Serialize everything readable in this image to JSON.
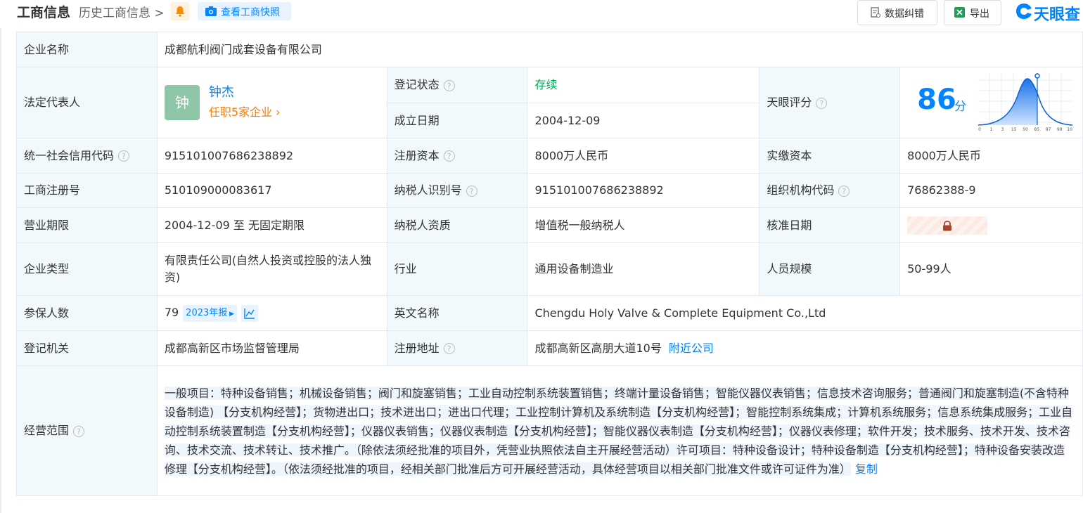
{
  "header": {
    "title": "工商信息",
    "history_link": "历史工商信息",
    "snapshot_label": "查看工商快照",
    "correct_label": "数据纠错",
    "export_label": "导出",
    "logo_text": "天眼查",
    "bell_icon": "bell-icon",
    "camera_icon": "camera-icon"
  },
  "company": {
    "name_label": "企业名称",
    "name": "成都航利阀门成套设备有限公司",
    "legal_rep_label": "法定代表人",
    "legal_rep": "钟杰",
    "avatar_char": "钟",
    "legal_rep_posts": "任职5家企业",
    "reg_status_label": "登记状态",
    "reg_status": "存续",
    "established_label": "成立日期",
    "established": "2004-12-09",
    "score_label": "天眼评分",
    "score": "86",
    "score_unit": "分",
    "score_ticks": [
      "0",
      "1",
      "3",
      "15",
      "50",
      "85",
      "97",
      "99",
      "100"
    ],
    "credit_code_label": "统一社会信用代码",
    "credit_code": "915101007686238892",
    "reg_capital_label": "注册资本",
    "reg_capital": "8000万人民币",
    "paid_capital_label": "实缴资本",
    "paid_capital": "8000万人民币",
    "reg_no_label": "工商注册号",
    "reg_no": "510109000083617",
    "taxpayer_id_label": "纳税人识别号",
    "taxpayer_id": "915101007686238892",
    "org_code_label": "组织机构代码",
    "org_code": "76862388-9",
    "term_label": "营业期限",
    "term": "2004-12-09 至 无固定期限",
    "tax_qual_label": "纳税人资质",
    "tax_qual": "增值税一般纳税人",
    "approval_label": "核准日期",
    "type_label": "企业类型",
    "type": "有限责任公司(自然人投资或控股的法人独资)",
    "industry_label": "行业",
    "industry": "通用设备制造业",
    "staff_label": "人员规模",
    "staff": "50-99人",
    "insured_label": "参保人数",
    "insured": "79",
    "report_chip": "2023年报",
    "en_name_label": "英文名称",
    "en_name": "Chengdu Holy Valve & Complete Equipment Co.,Ltd",
    "authority_label": "登记机关",
    "authority": "成都高新区市场监督管理局",
    "address_label": "注册地址",
    "address": "成都高新区高朋大道10号",
    "nearby": "附近公司",
    "scope_label": "经营范围",
    "scope": "一般项目：特种设备销售；机械设备销售；阀门和旋塞销售；工业自动控制系统装置销售；终端计量设备销售；智能仪器仪表销售；信息技术咨询服务；普通阀门和旋塞制造(不含特种设备制造) 【分支机构经营】；货物进出口；技术进出口；进出口代理；工业控制计算机及系统制造【分支机构经营】；智能控制系统集成；计算机系统服务；信息系统集成服务；工业自动控制系统装置制造【分支机构经营】；仪器仪表销售；仪器仪表制造【分支机构经营】；智能仪器仪表制造【分支机构经营】；仪器仪表修理；软件开发；技术服务、技术开发、技术咨询、技术交流、技术转让、技术推广。（除依法须经批准的项目外，凭营业执照依法自主开展经营活动）许可项目：特种设备设计；特种设备制造【分支机构经营】；特种设备安装改造修理【分支机构经营】。（依法须经批准的项目，经相关部门批准后方可开展经营活动，具体经营项目以相关部门批准文件或许可证件为准）",
    "copy_label": "复制",
    "help_glyph": "?"
  }
}
